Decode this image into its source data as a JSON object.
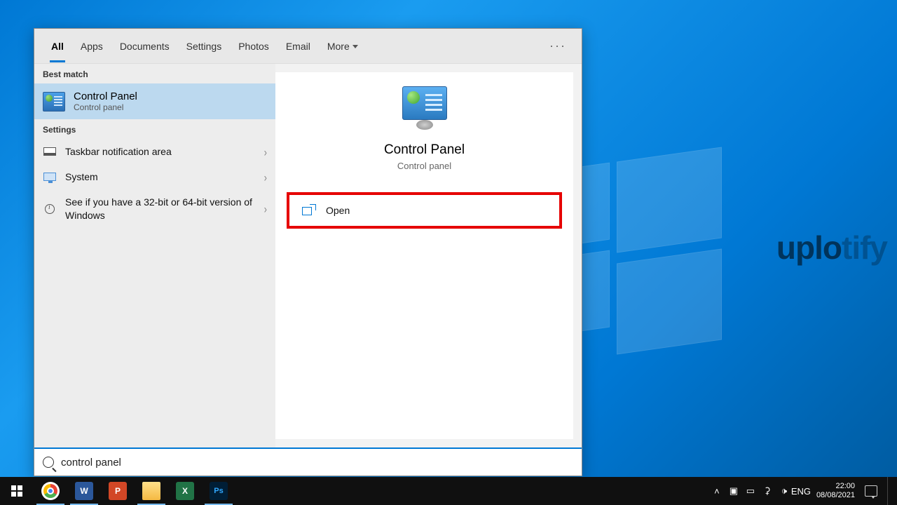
{
  "tabs": {
    "all": "All",
    "apps": "Apps",
    "documents": "Documents",
    "settings": "Settings",
    "photos": "Photos",
    "email": "Email",
    "more": "More"
  },
  "sections": {
    "best_match": "Best match",
    "settings": "Settings"
  },
  "best": {
    "title": "Control Panel",
    "sub": "Control panel"
  },
  "settings_items": {
    "taskbar": "Taskbar notification area",
    "system": "System",
    "bit": "See if you have a 32-bit or 64-bit version of Windows"
  },
  "preview": {
    "title": "Control Panel",
    "sub": "Control panel"
  },
  "action": {
    "open": "Open"
  },
  "search": {
    "value": "control panel"
  },
  "tray": {
    "lang": "ENG",
    "time": "22:00",
    "date": "08/08/2021"
  },
  "watermark": {
    "a": "uplo",
    "b": "tify"
  },
  "apps": {
    "word": "W",
    "ppt": "P",
    "excel": "X",
    "ps": "Ps"
  }
}
